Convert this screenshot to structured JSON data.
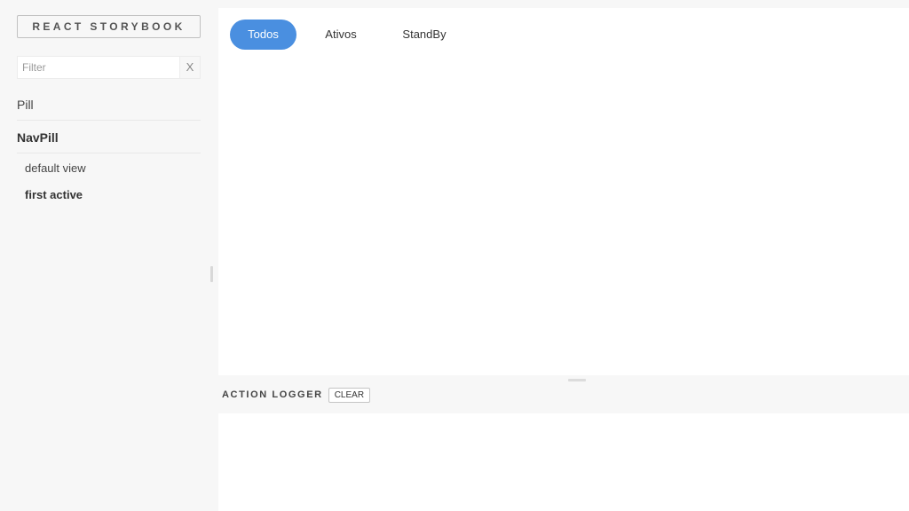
{
  "sidebar": {
    "brand": "REACT STORYBOOK",
    "filter": {
      "placeholder": "Filter",
      "value": "",
      "clear_label": "X"
    },
    "kinds": [
      {
        "label": "Pill"
      },
      {
        "label": "NavPill",
        "selected": true,
        "stories": [
          {
            "label": "default view"
          },
          {
            "label": "first active",
            "selected": true
          }
        ]
      }
    ]
  },
  "preview": {
    "pills": [
      {
        "label": "Todos",
        "active": true
      },
      {
        "label": "Ativos",
        "active": false
      },
      {
        "label": "StandBy",
        "active": false
      }
    ],
    "active_color": "#4a8fe0"
  },
  "action_logger": {
    "title": "ACTION LOGGER",
    "clear_label": "CLEAR"
  }
}
